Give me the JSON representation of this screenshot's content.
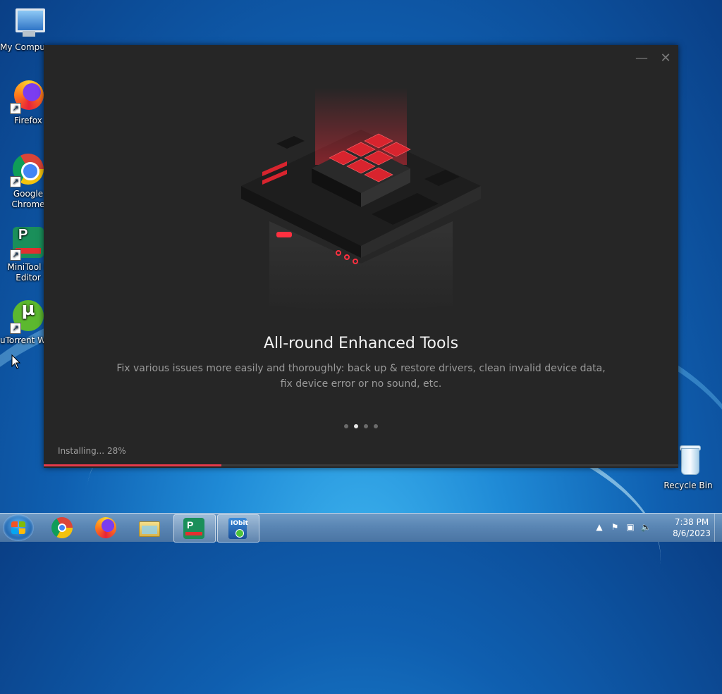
{
  "desktop": {
    "icons": [
      {
        "label": "My Computer"
      },
      {
        "label": "Firefox"
      },
      {
        "label": "Google Chrome"
      },
      {
        "label": "MiniTool P Editor"
      },
      {
        "label": "uTorrent W"
      },
      {
        "label": "Recycle Bin"
      }
    ]
  },
  "installer": {
    "slide": {
      "title": "All-round Enhanced Tools",
      "description": "Fix various issues more easily and thoroughly: back up & restore drivers, clean invalid device data, fix device error or no sound, etc."
    },
    "carousel": {
      "count": 4,
      "active": 1
    },
    "status": "Installing... 28%",
    "progress": 0.28,
    "accent_color": "#e43a4a"
  },
  "taskbar": {
    "pinned": [
      "windows-start",
      "chrome",
      "firefox",
      "explorer",
      "minitool",
      "iobit"
    ],
    "clock": {
      "time": "7:38 PM",
      "date": "8/6/2023"
    }
  }
}
